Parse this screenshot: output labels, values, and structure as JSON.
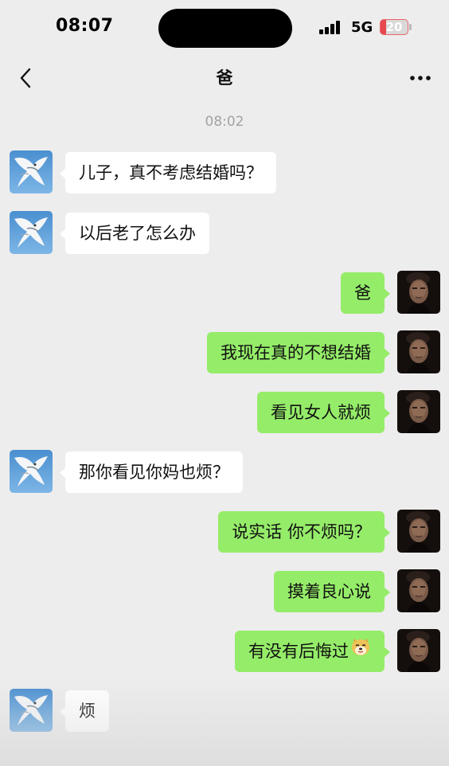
{
  "status_bar": {
    "time": "08:07",
    "network": "5G",
    "battery": "20",
    "battery_level": 0.2
  },
  "nav": {
    "title": "爸",
    "back_icon": "chevron-left-icon",
    "more_icon": "more-dots-icon"
  },
  "timestamp": "08:02",
  "messages": [
    {
      "side": "in",
      "text": "儿子，真不考虑结婚吗？"
    },
    {
      "side": "in",
      "text": "以后老了怎么办"
    },
    {
      "side": "out",
      "text": "爸"
    },
    {
      "side": "out",
      "text": "我现在真的不想结婚"
    },
    {
      "side": "out",
      "text": "看见女人就烦"
    },
    {
      "side": "in",
      "text": "那你看见你妈也烦？"
    },
    {
      "side": "out",
      "text": "说实话 你不烦吗？"
    },
    {
      "side": "out",
      "text": "摸着良心说"
    },
    {
      "side": "out",
      "text": "有没有后悔过",
      "emoji": "doge-emoji-icon"
    },
    {
      "side": "in",
      "text": "烦"
    }
  ],
  "colors": {
    "sent_bubble": "#95ec69",
    "received_bubble": "#ffffff",
    "background": "#ededed"
  }
}
